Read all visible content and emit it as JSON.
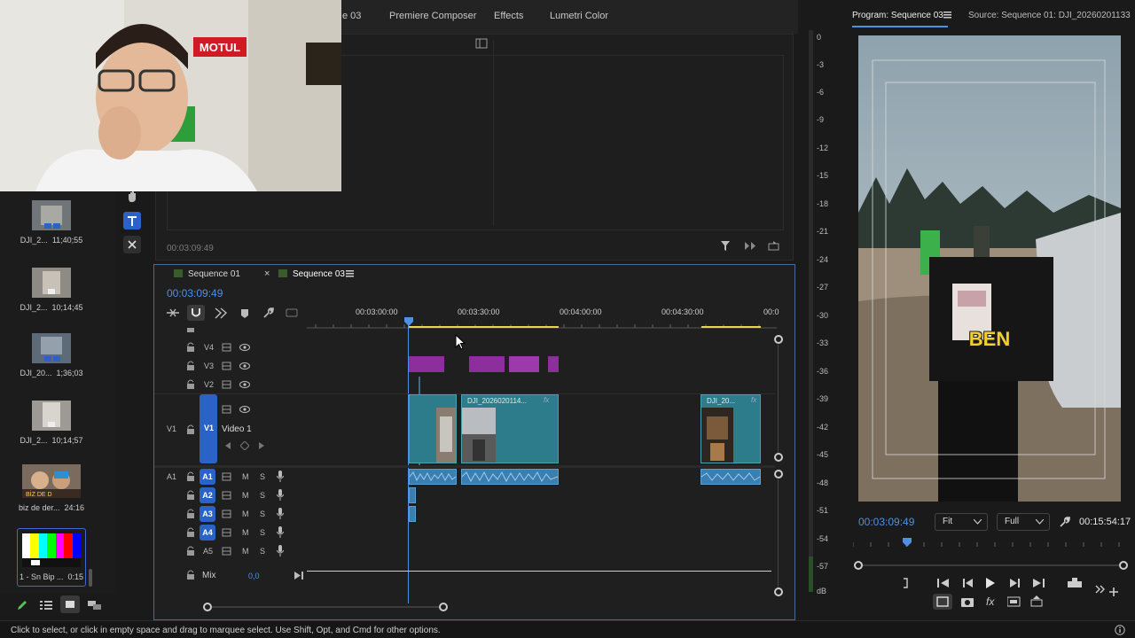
{
  "workspace_tabs": [
    "e 03",
    "Premiere Composer",
    "Effects",
    "Lumetri Color"
  ],
  "upper_panel": {
    "timecode": "00:03:09:49"
  },
  "bin_items": [
    {
      "name": "DJI_2...",
      "duration": "11;40;55"
    },
    {
      "name": "DJI_2...",
      "duration": "10;14;45"
    },
    {
      "name": "DJI_20...",
      "duration": "1;36;03"
    },
    {
      "name": "DJI_2...",
      "duration": "10;14;57"
    },
    {
      "name": "biz de der...",
      "duration": "24:16"
    },
    {
      "name": "1 - Sn Bip ...",
      "duration": "0:15"
    }
  ],
  "timeline": {
    "tabs": [
      "Sequence 01",
      "Sequence 03"
    ],
    "timecode": "00:03:09:49",
    "ruler": [
      "00:03:00:00",
      "00:03:30:00",
      "00:04:00:00",
      "00:04:30:00",
      "00:0"
    ],
    "video_tracks": [
      "V4",
      "V3",
      "V2",
      "V1"
    ],
    "v1_name": "Video 1",
    "source_patch": {
      "v": "V1",
      "a": "A1"
    },
    "audio_tracks": [
      "A1",
      "A2",
      "A3",
      "A4",
      "A5"
    ],
    "mix_label": "Mix",
    "mix_value": "0,0",
    "clip_a_name": "DJI_2026020114...",
    "clip_b_name": "DJI_20...",
    "fx": "fx",
    "m": "M",
    "s": "S"
  },
  "program": {
    "title": "Program: Sequence 03",
    "source_title": "Source: Sequence 01: DJI_20260201133",
    "overlay_text": "BEN",
    "timecode": "00:03:09:49",
    "fit": "Fit",
    "quality": "Full",
    "duration": "00:15:54:17"
  },
  "meter_labels": [
    "0",
    "-3",
    "-6",
    "-9",
    "-12",
    "-15",
    "-18",
    "-21",
    "-24",
    "-27",
    "-30",
    "-33",
    "-36",
    "-39",
    "-42",
    "-45",
    "-48",
    "-51",
    "-54",
    "-57",
    "dB"
  ],
  "status_text": "Click to select, or click in empty space and drag to marquee select. Use Shift, Opt, and Cmd for other options."
}
